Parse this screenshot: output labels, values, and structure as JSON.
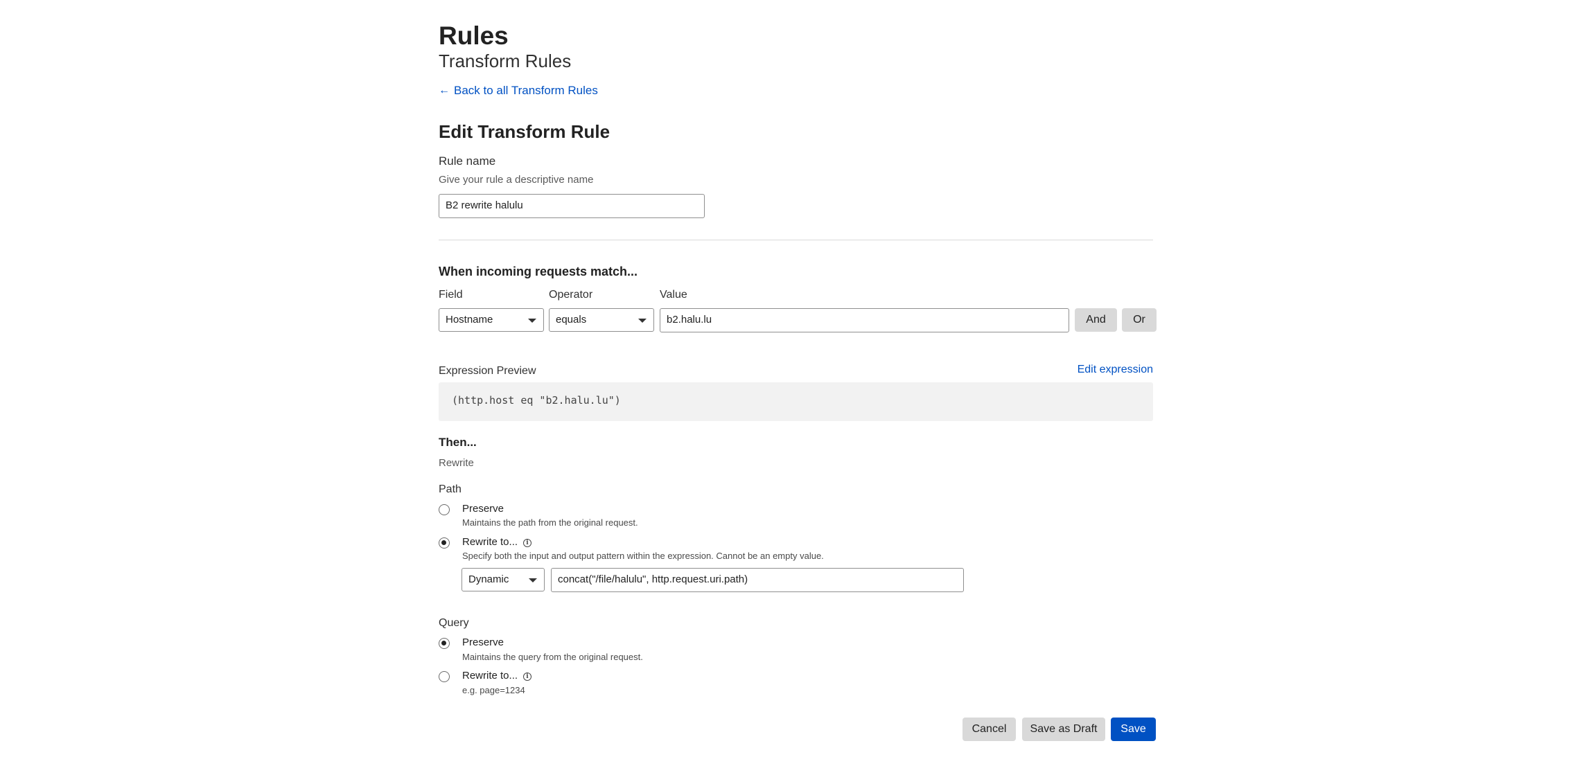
{
  "header": {
    "title": "Rules",
    "subtitle": "Transform Rules",
    "back_link": "Back to all Transform Rules"
  },
  "form": {
    "heading": "Edit Transform Rule",
    "rule_name_label": "Rule name",
    "rule_name_hint": "Give your rule a descriptive name",
    "rule_name_value": "B2 rewrite halulu"
  },
  "match": {
    "title": "When incoming requests match...",
    "field_label": "Field",
    "operator_label": "Operator",
    "value_label": "Value",
    "field_value": "Hostname",
    "operator_value": "equals",
    "value_value": "b2.halu.lu",
    "and_label": "And",
    "or_label": "Or"
  },
  "expression": {
    "label": "Expression Preview",
    "edit_link": "Edit expression",
    "code": "(http.host eq \"b2.halu.lu\")"
  },
  "then": {
    "title": "Then...",
    "action": "Rewrite"
  },
  "path": {
    "label": "Path",
    "preserve_label": "Preserve",
    "preserve_hint": "Maintains the path from the original request.",
    "rewrite_label": "Rewrite to...",
    "rewrite_hint": "Specify both the input and output pattern within the expression. Cannot be an empty value.",
    "mode_value": "Dynamic",
    "expression_value": "concat(\"/file/halulu\", http.request.uri.path)",
    "selected": "rewrite"
  },
  "query": {
    "label": "Query",
    "preserve_label": "Preserve",
    "preserve_hint": "Maintains the query from the original request.",
    "rewrite_label": "Rewrite to...",
    "rewrite_hint": "e.g. page=1234",
    "selected": "preserve"
  },
  "actions": {
    "cancel": "Cancel",
    "draft": "Save as Draft",
    "save": "Save"
  },
  "colors": {
    "link": "#0051c3",
    "primary_button": "#0051c3",
    "secondary_button": "#d9d9d9",
    "preview_bg": "#f2f2f2"
  },
  "icons": {
    "back": "arrow-left-icon",
    "info": "info-icon",
    "dropdown": "caret-down-icon"
  }
}
